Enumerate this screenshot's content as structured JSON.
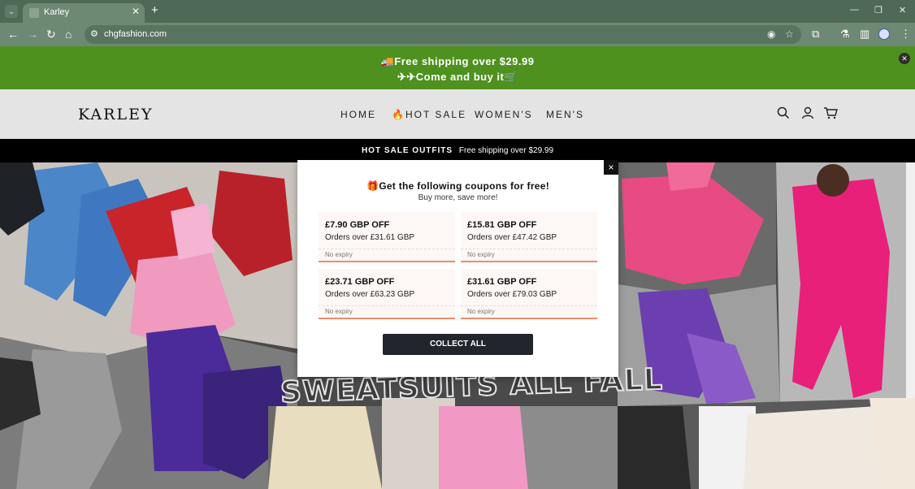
{
  "browser": {
    "tab_title": "Karley",
    "new_tab": "+",
    "url": "chgfashion.com"
  },
  "announcement": {
    "line1": "🚚Free shipping over $29.99",
    "line2": "✈✈Come and buy it🛒",
    "close": "✕"
  },
  "header": {
    "logo": "KARLEY",
    "nav": [
      "HOME",
      "🔥HOT SALE",
      "WOMEN'S",
      "MEN'S"
    ]
  },
  "promo": {
    "label": "HOT SALE OUTFITS",
    "text": "Free shipping over $29.99"
  },
  "hero": {
    "text": "SWEATSUITS ALL FALL"
  },
  "modal": {
    "close": "×",
    "gift": "🎁",
    "title": "Get the following coupons for free!",
    "subtitle": "Buy more, save more!",
    "coupons": [
      {
        "amount": "£7.90 GBP OFF",
        "condition": "Orders over £31.61 GBP",
        "expiry": "No expiry"
      },
      {
        "amount": "£15.81 GBP OFF",
        "condition": "Orders over £47.42 GBP",
        "expiry": "No expiry"
      },
      {
        "amount": "£23.71 GBP OFF",
        "condition": "Orders over £63.23 GBP",
        "expiry": "No expiry"
      },
      {
        "amount": "£31.61 GBP OFF",
        "condition": "Orders over £79.03 GBP",
        "expiry": "No expiry"
      }
    ],
    "collect_button": "COLLECT ALL"
  },
  "colors": {
    "announcement_bg": "#4e911f",
    "browser_chrome": "#6d8873",
    "coupon_accent": "#f08a6e",
    "button_bg": "#22252b"
  }
}
